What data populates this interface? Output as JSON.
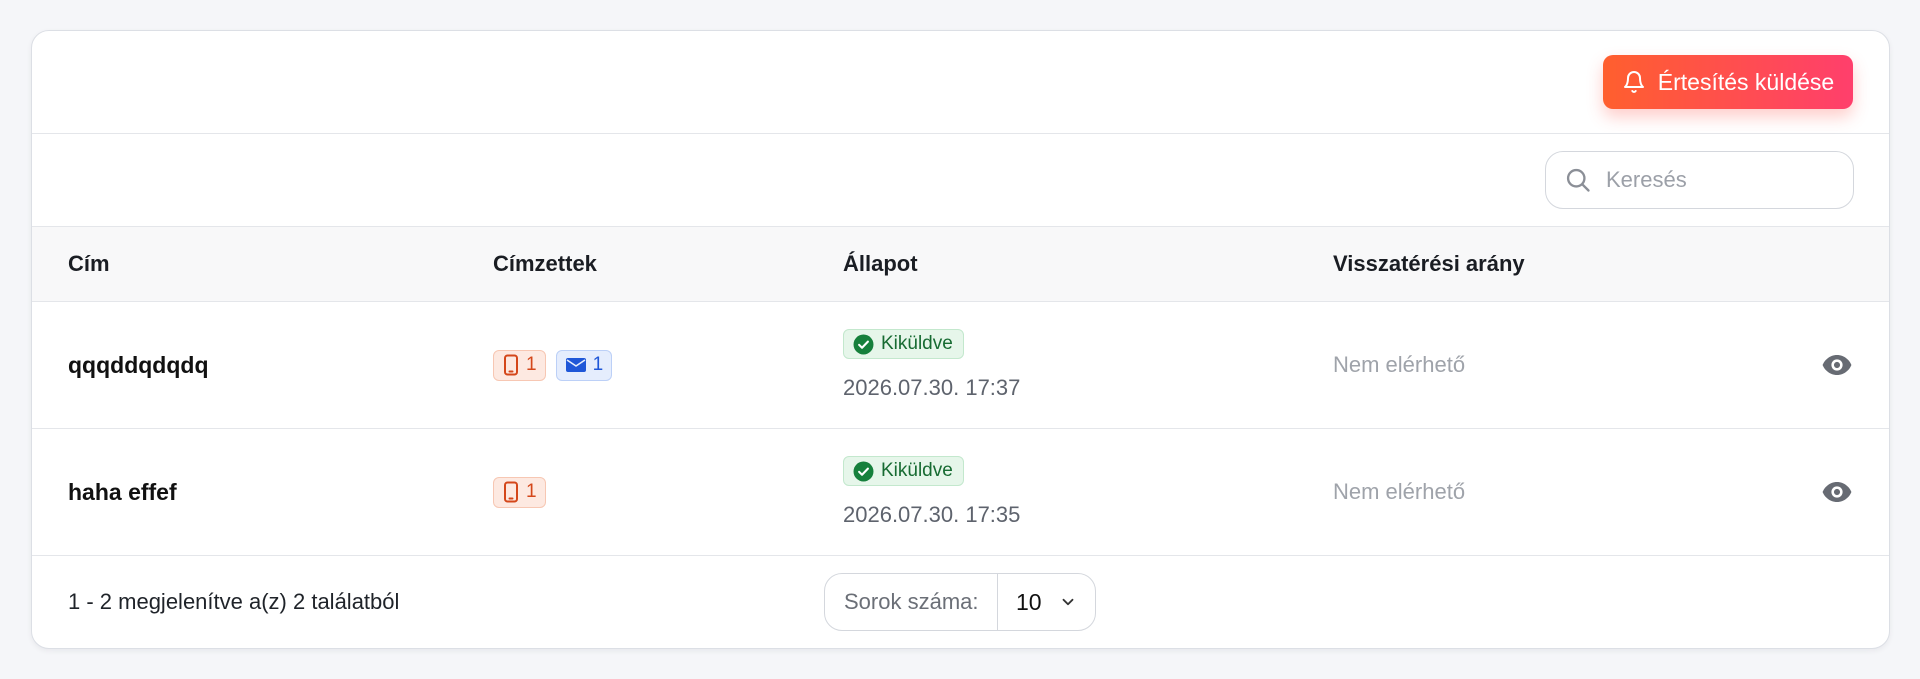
{
  "header": {
    "send_button_label": "Értesítés küldése"
  },
  "search": {
    "placeholder": "Keresés"
  },
  "table": {
    "columns": [
      "Cím",
      "Címzettek",
      "Állapot",
      "Visszatérési arány"
    ],
    "rows": [
      {
        "title": "qqqddqdqdq",
        "recipients": {
          "phone_count": "1",
          "email_count": "1"
        },
        "status": "Kiküldve",
        "time": "2026.07.30. 17:37",
        "return_rate": "Nem elérhető"
      },
      {
        "title": "haha effef",
        "recipients": {
          "phone_count": "1"
        },
        "status": "Kiküldve",
        "time": "2026.07.30. 17:35",
        "return_rate": "Nem elérhető"
      }
    ]
  },
  "footer": {
    "info": "1 - 2 megjelenítve a(z) 2 találatból",
    "rows_label": "Sorok száma:",
    "rows_value": "10"
  },
  "colors": {
    "accent_start": "#ff5f2e",
    "accent_end": "#ff3f6c",
    "status_green": "#176b32",
    "phone_chip": "#d4471a",
    "mail_chip": "#1f57d8"
  },
  "icons": [
    "bell-icon",
    "search-icon",
    "phone-icon",
    "mail-icon",
    "check-circle-icon",
    "eye-icon",
    "chevron-down-icon"
  ]
}
